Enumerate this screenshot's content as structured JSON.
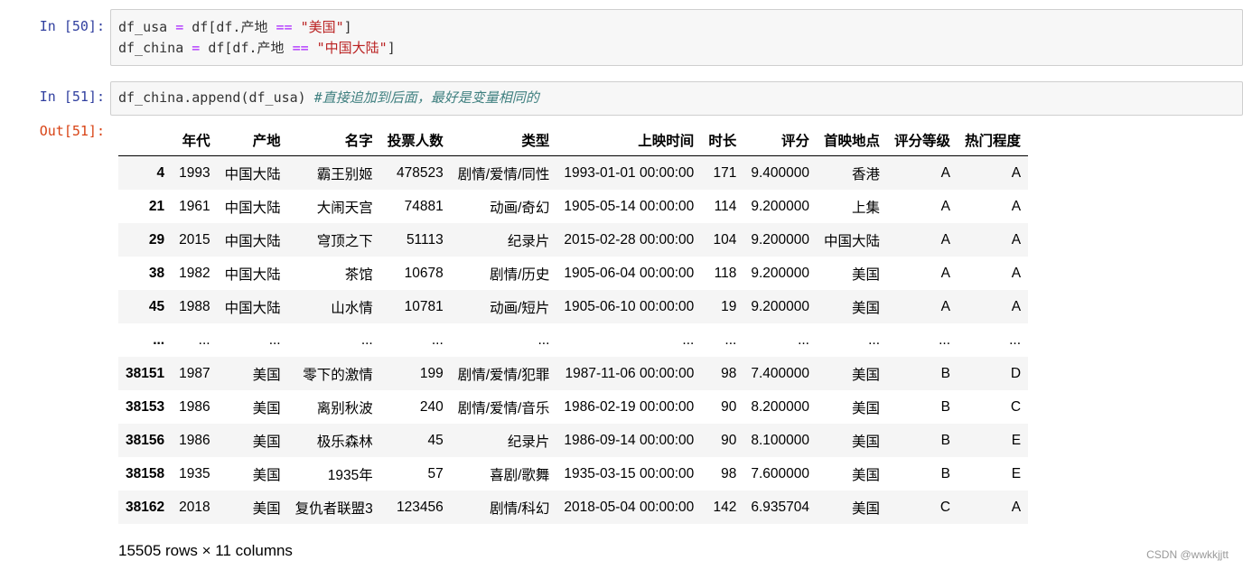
{
  "cells": [
    {
      "prompt": "In  [50]:",
      "lines": [
        [
          {
            "t": "df_usa ",
            "c": ""
          },
          {
            "t": "=",
            "c": "op"
          },
          {
            "t": " df[df.产地 ",
            "c": ""
          },
          {
            "t": "==",
            "c": "op"
          },
          {
            "t": " ",
            "c": ""
          },
          {
            "t": "\"美国\"",
            "c": "str"
          },
          {
            "t": "]",
            "c": ""
          }
        ],
        [
          {
            "t": "df_china ",
            "c": ""
          },
          {
            "t": "=",
            "c": "op"
          },
          {
            "t": " df[df.产地 ",
            "c": ""
          },
          {
            "t": "==",
            "c": "op"
          },
          {
            "t": " ",
            "c": ""
          },
          {
            "t": "\"中国大陆\"",
            "c": "str"
          },
          {
            "t": "]",
            "c": ""
          }
        ]
      ]
    },
    {
      "prompt": "In  [51]:",
      "lines": [
        [
          {
            "t": "df_china.append(df_usa) ",
            "c": ""
          },
          {
            "t": "#直接追加到后面，最好是变量相同的",
            "c": "cmt"
          }
        ]
      ]
    }
  ],
  "output": {
    "prompt": "Out[51]:",
    "columns": [
      "",
      "年代",
      "产地",
      "名字",
      "投票人数",
      "类型",
      "上映时间",
      "时长",
      "评分",
      "首映地点",
      "评分等级",
      "热门程度"
    ],
    "rows": [
      [
        "4",
        "1993",
        "中国大陆",
        "霸王别姬",
        "478523",
        "剧情/爱情/同性",
        "1993-01-01 00:00:00",
        "171",
        "9.400000",
        "香港",
        "A",
        "A"
      ],
      [
        "21",
        "1961",
        "中国大陆",
        "大闹天宫",
        "74881",
        "动画/奇幻",
        "1905-05-14 00:00:00",
        "114",
        "9.200000",
        "上集",
        "A",
        "A"
      ],
      [
        "29",
        "2015",
        "中国大陆",
        "穹顶之下",
        "51113",
        "纪录片",
        "2015-02-28 00:00:00",
        "104",
        "9.200000",
        "中国大陆",
        "A",
        "A"
      ],
      [
        "38",
        "1982",
        "中国大陆",
        "茶馆",
        "10678",
        "剧情/历史",
        "1905-06-04 00:00:00",
        "118",
        "9.200000",
        "美国",
        "A",
        "A"
      ],
      [
        "45",
        "1988",
        "中国大陆",
        "山水情",
        "10781",
        "动画/短片",
        "1905-06-10 00:00:00",
        "19",
        "9.200000",
        "美国",
        "A",
        "A"
      ],
      [
        "...",
        "...",
        "...",
        "...",
        "...",
        "...",
        "...",
        "...",
        "...",
        "...",
        "...",
        "..."
      ],
      [
        "38151",
        "1987",
        "美国",
        "零下的激情",
        "199",
        "剧情/爱情/犯罪",
        "1987-11-06 00:00:00",
        "98",
        "7.400000",
        "美国",
        "B",
        "D"
      ],
      [
        "38153",
        "1986",
        "美国",
        "离别秋波",
        "240",
        "剧情/爱情/音乐",
        "1986-02-19 00:00:00",
        "90",
        "8.200000",
        "美国",
        "B",
        "C"
      ],
      [
        "38156",
        "1986",
        "美国",
        "极乐森林",
        "45",
        "纪录片",
        "1986-09-14 00:00:00",
        "90",
        "8.100000",
        "美国",
        "B",
        "E"
      ],
      [
        "38158",
        "1935",
        "美国",
        "1935年",
        "57",
        "喜剧/歌舞",
        "1935-03-15 00:00:00",
        "98",
        "7.600000",
        "美国",
        "B",
        "E"
      ],
      [
        "38162",
        "2018",
        "美国",
        "复仇者联盟3",
        "123456",
        "剧情/科幻",
        "2018-05-04 00:00:00",
        "142",
        "6.935704",
        "美国",
        "C",
        "A"
      ]
    ],
    "shape_text": "15505 rows × 11 columns"
  },
  "watermark": "CSDN @wwkkjjtt"
}
